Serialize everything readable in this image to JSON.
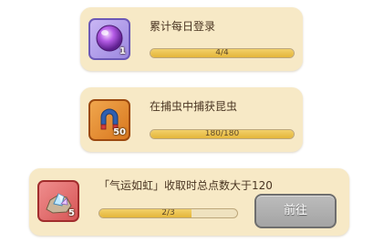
{
  "quests": [
    {
      "title": "累计每日登录",
      "progress_text": "4/4",
      "progress": 1.0,
      "reward_icon": "purple-orb-icon",
      "reward_count": "1"
    },
    {
      "title": "在捕虫中捕获昆虫",
      "progress_text": "180/180",
      "progress": 1.0,
      "reward_icon": "magnet-icon",
      "reward_count": "50"
    },
    {
      "title": "「气运如虹」收取时总点数大于120",
      "progress_text": "2/3",
      "progress": 0.667,
      "reward_icon": "crystal-rock-icon",
      "reward_count": "5",
      "button_label": "前往"
    }
  ],
  "colors": {
    "card_bg": "#f7e9c6",
    "bar_fill": "#e4b53a",
    "button_disabled": "#a4a4a4"
  }
}
